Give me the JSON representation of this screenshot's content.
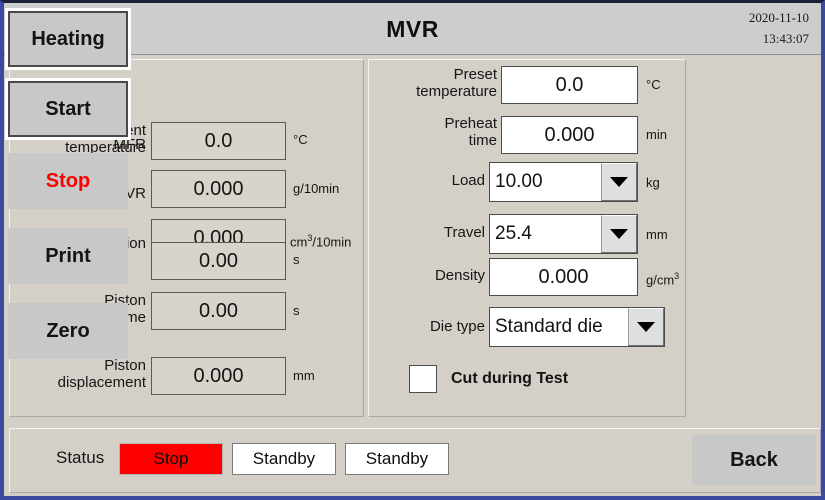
{
  "window": {
    "title": "MVR",
    "date": "2020-11-10",
    "time": "13:43:07"
  },
  "measurements": {
    "panel_name": "measured-values",
    "rows": [
      {
        "label_line1": "Current",
        "label_line2": "temperature",
        "value": "0.0",
        "unit": "°C",
        "unit_sup": ""
      },
      {
        "label_line1": "MFR",
        "label_line2": "",
        "value": "0.000",
        "unit": "g/10min",
        "unit_sup": ""
      },
      {
        "label_line1": "MVR",
        "label_line2": "",
        "value": "0.000",
        "unit": "cm",
        "unit_sup": "3",
        "unit_tail": "/10min"
      },
      {
        "label_line1": "Test duration",
        "label_line2": "",
        "value": "0.00",
        "unit": "s",
        "unit_sup": ""
      },
      {
        "label_line1": "Piston",
        "label_line2": "moveing time",
        "value": "0.00",
        "unit": "s",
        "unit_sup": ""
      },
      {
        "label_line1": "Piston",
        "label_line2": "displacement",
        "value": "0.000",
        "unit": "mm",
        "unit_sup": ""
      }
    ]
  },
  "parameters": {
    "panel_name": "test-parameters",
    "preset_temperature": {
      "label_line1": "Preset",
      "label_line2": "temperature",
      "value": "0.0",
      "unit": "°C"
    },
    "preheat_time": {
      "label_line1": "Preheat",
      "label_line2": "time",
      "value": "0.000",
      "unit": "min"
    },
    "load": {
      "label": "Load",
      "value": "10.00",
      "unit": "kg",
      "icon": "chevron-down-icon"
    },
    "travel": {
      "label": "Travel",
      "value": "25.4",
      "unit": "mm",
      "icon": "chevron-down-icon"
    },
    "density": {
      "label": "Density",
      "value": "0.000",
      "unit": "g/cm",
      "unit_sup": "3"
    },
    "die_type": {
      "label": "Die type",
      "value": "Standard die",
      "icon": "chevron-down-icon"
    },
    "cut_during_test": {
      "label": "Cut during Test",
      "checked": false
    }
  },
  "actions": {
    "buttons": [
      {
        "label": "Heating",
        "style": "raised",
        "color": "#141414"
      },
      {
        "label": "Start",
        "style": "raised",
        "color": "#141414"
      },
      {
        "label": "Stop",
        "style": "flat",
        "color": "#ff0000"
      },
      {
        "label": "Print",
        "style": "flat",
        "color": "#141414"
      },
      {
        "label": "Zero",
        "style": "flat",
        "color": "#141414"
      }
    ]
  },
  "status_bar": {
    "label": "Status",
    "items": [
      {
        "text": "Stop",
        "bg": "#ff0000"
      },
      {
        "text": "Standby",
        "bg": "#ffffff"
      },
      {
        "text": "Standby",
        "bg": "#ffffff"
      }
    ],
    "back_label": "Back"
  }
}
